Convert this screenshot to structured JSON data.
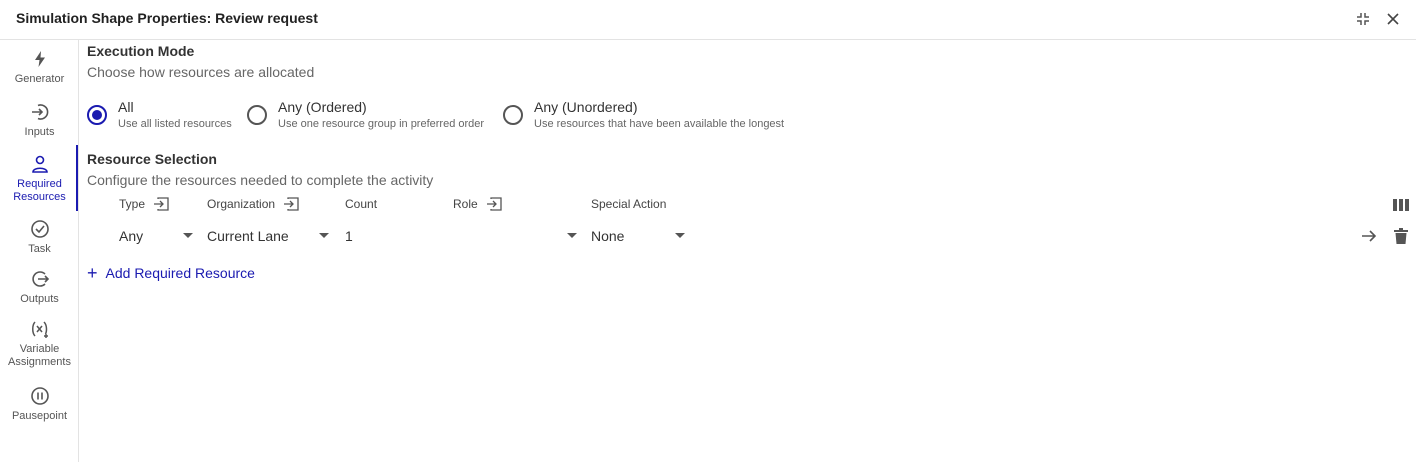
{
  "window": {
    "title": "Simulation Shape Properties: Review request"
  },
  "sidebar": {
    "items": [
      {
        "label": "Generator",
        "icon": "bolt-icon"
      },
      {
        "label": "Inputs",
        "icon": "login-arrow-icon"
      },
      {
        "label": "Required Resources",
        "icon": "person-icon"
      },
      {
        "label": "Task",
        "icon": "check-circle-icon"
      },
      {
        "label": "Outputs",
        "icon": "logout-arrow-icon"
      },
      {
        "label": "Variable Assignments",
        "icon": "variable-icon"
      },
      {
        "label": "Pausepoint",
        "icon": "pause-circle-icon"
      }
    ],
    "active": "Required Resources"
  },
  "execution_mode": {
    "title": "Execution Mode",
    "subtitle": "Choose how resources are allocated",
    "options": [
      {
        "label": "All",
        "desc": "Use all listed resources",
        "checked": true
      },
      {
        "label": "Any (Ordered)",
        "desc": "Use one resource group in preferred order",
        "checked": false
      },
      {
        "label": "Any (Unordered)",
        "desc": "Use resources that have been available the longest",
        "checked": false
      }
    ]
  },
  "resource_selection": {
    "title": "Resource Selection",
    "subtitle": "Configure the resources needed to complete the activity",
    "columns": [
      "Type",
      "Organization",
      "Count",
      "Role",
      "Special Action"
    ],
    "rows": [
      {
        "type": "Any",
        "organization": "Current Lane",
        "count": "1",
        "role": "",
        "special_action": "None"
      }
    ],
    "add_label": "Add Required Resource"
  },
  "colors": {
    "accent": "#1a1ab0",
    "border": "#e3e3e3",
    "text": "#333333"
  }
}
